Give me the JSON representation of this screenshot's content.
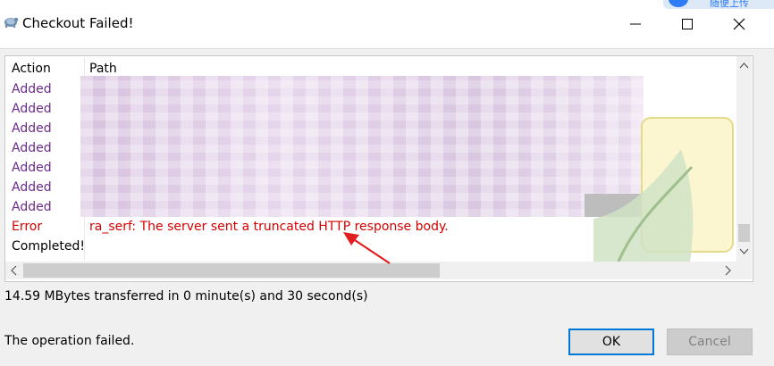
{
  "window": {
    "title": "Checkout Failed!",
    "app_icon": "tortoise-icon",
    "controls": [
      "minimize-icon",
      "maximize-icon",
      "close-icon"
    ]
  },
  "tray_widget": {
    "text": "随便上传"
  },
  "log": {
    "columns": {
      "action": "Action",
      "path": "Path"
    },
    "rows": [
      {
        "action": "Added",
        "path": ""
      },
      {
        "action": "Added",
        "path": ""
      },
      {
        "action": "Added",
        "path": ""
      },
      {
        "action": "Added",
        "path": ""
      },
      {
        "action": "Added",
        "path": ""
      },
      {
        "action": "Added",
        "path": ""
      },
      {
        "action": "Added",
        "path": ""
      },
      {
        "action": "Error",
        "path": "ra_serf: The server sent a truncated HTTP response body."
      },
      {
        "action": "Completed!",
        "path": ""
      }
    ]
  },
  "transfer_summary": "14.59 MBytes transferred in 0 minute(s) and 30 second(s)",
  "status_message": "The operation failed.",
  "buttons": {
    "ok": "OK",
    "cancel": "Cancel"
  },
  "colors": {
    "added": "#6b2a8a",
    "error": "#d40000",
    "accent": "#0078d7",
    "annotation_arrow": "#e02020"
  }
}
